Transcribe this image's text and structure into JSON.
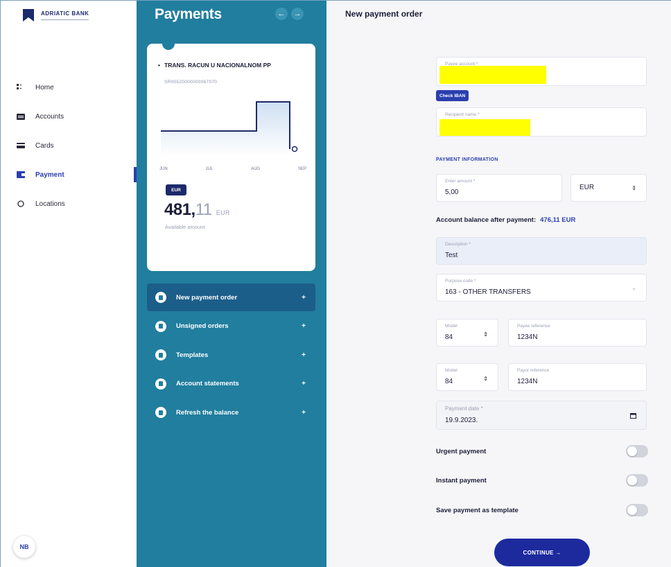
{
  "brand": {
    "name": "ADRIATIC BANK"
  },
  "nav": {
    "items": [
      {
        "label": "Home",
        "icon": "home-icon"
      },
      {
        "label": "Accounts",
        "icon": "accounts-icon"
      },
      {
        "label": "Cards",
        "icon": "card-icon"
      },
      {
        "label": "Payment",
        "icon": "payment-icon",
        "active": true
      },
      {
        "label": "Locations",
        "icon": "location-icon"
      }
    ]
  },
  "user": {
    "initials": "NB"
  },
  "panel": {
    "title": "Payments",
    "prev_icon": "arrow-left-icon",
    "next_icon": "arrow-right-icon"
  },
  "account": {
    "name": "TRANS. RACUN U NACIONALNOM PP",
    "iban": "SR00520000000067070",
    "months": [
      "JUN",
      "JUL",
      "AUG",
      "SEP"
    ],
    "currency_badge": "EUR",
    "balance_int": "481,",
    "balance_dec": "11",
    "balance_currency": "EUR",
    "available_label": "Available amount"
  },
  "menu": {
    "items": [
      {
        "label": "New payment order",
        "icon": "document-icon",
        "active": true
      },
      {
        "label": "Unsigned orders",
        "icon": "document-icon"
      },
      {
        "label": "Templates",
        "icon": "template-icon"
      },
      {
        "label": "Account statements",
        "icon": "statement-icon"
      },
      {
        "label": "Refresh the balance",
        "icon": "refresh-icon"
      }
    ],
    "plus": "+"
  },
  "form": {
    "title": "New payment order",
    "payee_account_label": "Payee account *",
    "check_iban": "Check IBAN",
    "recipient_name_label": "Recipient name *",
    "section_payment_info": "PAYMENT INFORMATION",
    "amount_label": "Enter amount *",
    "amount_value": "5,00",
    "currency_value": "EUR",
    "balance_after_label": "Account balance after payment:",
    "balance_after_value": "476,11 EUR",
    "description_label": "Description *",
    "description_value": "Test",
    "purpose_code_label": "Purpose code *",
    "purpose_code_value": "163 - OTHER TRANSFERS",
    "model_label": "Model",
    "model1_value": "84",
    "payee_reference_label": "Payee reference",
    "payee_reference_value": "1234N",
    "model2_value": "84",
    "payor_reference_label": "Payor reference",
    "payor_reference_value": "1234N",
    "payment_date_label": "Payment date *",
    "payment_date_value": "19.9.2023.",
    "urgent_payment": "Urgent payment",
    "instant_payment": "Instant payment",
    "save_template": "Save payment as template",
    "continue_label": "CONTINUE →"
  },
  "colors": {
    "sidebar_teal": "#217e9e",
    "brand_blue": "#2b3fae",
    "button_navy": "#1c2a9e",
    "redaction_yellow": "#ffff00"
  }
}
